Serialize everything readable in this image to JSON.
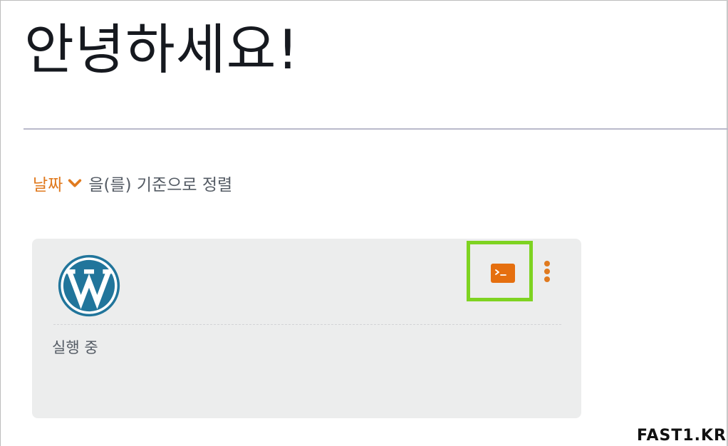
{
  "header": {
    "title": "안녕하세요!"
  },
  "sort": {
    "field_label": "날짜",
    "suffix": "을(를) 기준으로 정렬"
  },
  "instance_card": {
    "logo_icon": "wordpress-logo-icon",
    "status": "실행 중",
    "actions": {
      "connect_icon": "terminal-icon",
      "more_icon": "kebab-menu-icon"
    }
  },
  "watermark": {
    "text": "FAST1.KR"
  },
  "colors": {
    "accent": "#e07a1f",
    "terminal_button": "#e56f0f",
    "highlight": "#7ed321",
    "wordpress_blue": "#21759b",
    "card_background": "#eceded"
  }
}
